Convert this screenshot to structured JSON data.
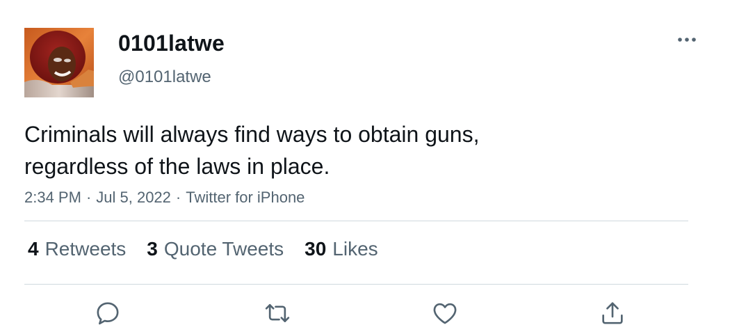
{
  "author": {
    "display_name": "0101latwe",
    "handle": "@0101latwe"
  },
  "tweet": {
    "text": "Criminals will always find ways to obtain guns,\nregardless of the laws in place.",
    "time": "2:34 PM",
    "date": "Jul 5, 2022",
    "source": "Twitter for iPhone",
    "separator": "·"
  },
  "stats": {
    "retweets": {
      "count": "4",
      "label": "Retweets"
    },
    "quote_tweets": {
      "count": "3",
      "label": "Quote Tweets"
    },
    "likes": {
      "count": "30",
      "label": "Likes"
    }
  },
  "icons": {
    "more": "more-horizontal-icon",
    "reply": "reply-bubble-icon",
    "retweet": "retweet-icon",
    "like": "heart-icon",
    "share": "share-icon"
  },
  "colors": {
    "text_primary": "#0f1419",
    "text_secondary": "#536471",
    "divider": "#cfd9de"
  }
}
